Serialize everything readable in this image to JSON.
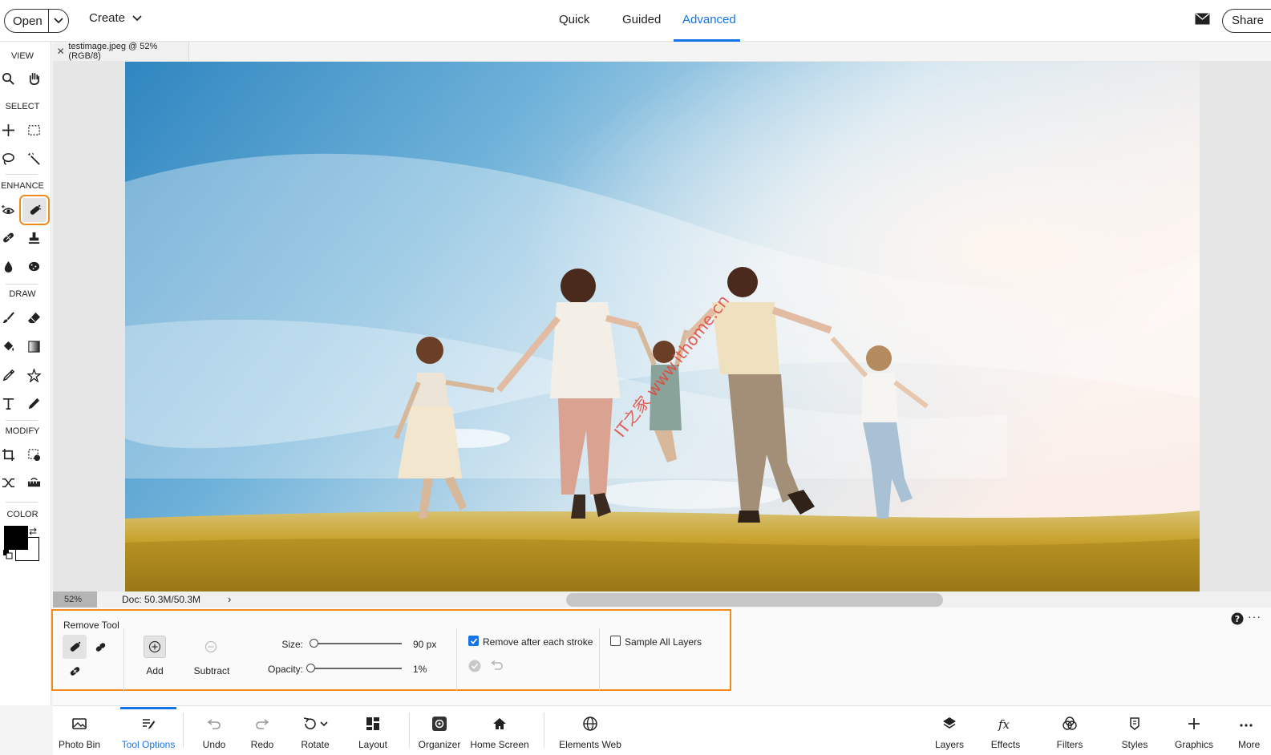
{
  "topbar": {
    "open_label": "Open",
    "create_label": "Create",
    "modes": [
      "Quick",
      "Guided",
      "Advanced"
    ],
    "active_mode": "Advanced",
    "share_label": "Share"
  },
  "toolbox": {
    "sections": {
      "view": "VIEW",
      "select": "SELECT",
      "enhance": "ENHANCE",
      "draw": "DRAW",
      "modify": "MODIFY",
      "color": "COLOR"
    },
    "foreground_color": "#000000",
    "background_color": "#ffffff"
  },
  "document": {
    "tab_title": "testimage.jpeg @ 52% (RGB/8)",
    "zoom": "52%",
    "doc_size": "Doc: 50.3M/50.3M",
    "watermark": "IT之家 www.ithome.cn"
  },
  "tool_options": {
    "title": "Remove Tool",
    "add_label": "Add",
    "subtract_label": "Subtract",
    "size_label": "Size:",
    "size_value": "90 px",
    "size_fraction": 0.0,
    "opacity_label": "Opacity:",
    "opacity_value": "1%",
    "opacity_fraction": 0.01,
    "remove_after_stroke_label": "Remove after each stroke",
    "remove_after_stroke_checked": true,
    "sample_all_layers_label": "Sample All Layers",
    "sample_all_layers_checked": false
  },
  "bottombar": {
    "photo_bin": "Photo Bin",
    "tool_options": "Tool Options",
    "undo": "Undo",
    "redo": "Redo",
    "rotate": "Rotate",
    "layout": "Layout",
    "organizer": "Organizer",
    "home_screen": "Home Screen",
    "elements_web": "Elements Web",
    "layers": "Layers",
    "effects": "Effects",
    "filters": "Filters",
    "styles": "Styles",
    "graphics": "Graphics",
    "more": "More"
  },
  "colors": {
    "accent": "#1473e6",
    "highlight": "#f28b1e"
  }
}
